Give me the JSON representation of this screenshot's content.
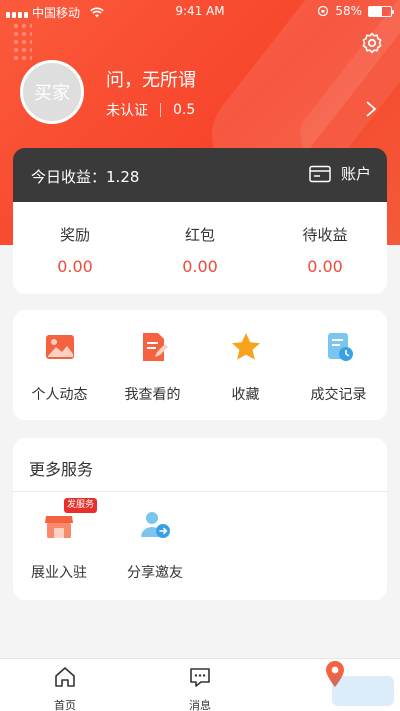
{
  "status_bar": {
    "carrier": "中国移动",
    "time": "9:41 AM",
    "battery": "58%",
    "battery_level": 0.58
  },
  "profile": {
    "avatar_text": "买家",
    "name": "问，无所谓",
    "verification": "未认证",
    "score": "0.5"
  },
  "earnings": {
    "today_label": "今日收益：",
    "today_value": "1.28",
    "account_label": "账户"
  },
  "stats": [
    {
      "label": "奖励",
      "value": "0.00"
    },
    {
      "label": "红包",
      "value": "0.00"
    },
    {
      "label": "待收益",
      "value": "0.00"
    }
  ],
  "quick_actions": [
    {
      "label": "个人动态",
      "icon": "picture-icon"
    },
    {
      "label": "我查看的",
      "icon": "document-edit-icon"
    },
    {
      "label": "收藏",
      "icon": "star-icon"
    },
    {
      "label": "成交记录",
      "icon": "record-clock-icon"
    }
  ],
  "more_services": {
    "title": "更多服务",
    "items": [
      {
        "label": "展业入驻",
        "icon": "shop-icon",
        "badge": "发服务"
      },
      {
        "label": "分享邀友",
        "icon": "user-share-icon"
      }
    ]
  },
  "tabbar": {
    "tabs": [
      {
        "label": "首页",
        "icon": "home-icon"
      },
      {
        "label": "消息",
        "icon": "message-icon"
      }
    ]
  },
  "colors": {
    "brand": "#f7452b",
    "value_red": "#f04a3a",
    "dark_bar": "#3a3a3a",
    "page_bg": "#f4f4f4"
  }
}
